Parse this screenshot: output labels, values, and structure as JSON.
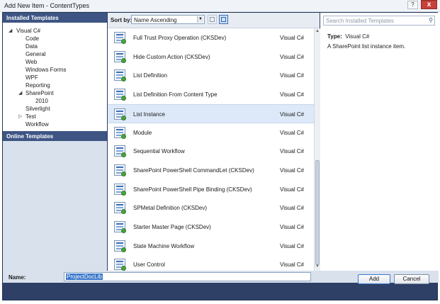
{
  "window": {
    "title": "Add New Item - ContentTypes",
    "help_label": "?",
    "close_label": "x"
  },
  "left": {
    "header": "Installed Templates",
    "tree": [
      {
        "label": "Visual C#",
        "level": 0,
        "arrow": "expanded"
      },
      {
        "label": "Code",
        "level": 1
      },
      {
        "label": "Data",
        "level": 1
      },
      {
        "label": "General",
        "level": 1
      },
      {
        "label": "Web",
        "level": 1
      },
      {
        "label": "Windows Forms",
        "level": 1
      },
      {
        "label": "WPF",
        "level": 1
      },
      {
        "label": "Reporting",
        "level": 1
      },
      {
        "label": "SharePoint",
        "level": 1,
        "arrow": "expanded"
      },
      {
        "label": "2010",
        "level": 2
      },
      {
        "label": "Silverlight",
        "level": 1
      },
      {
        "label": "Test",
        "level": 1,
        "arrow": "collapsed"
      },
      {
        "label": "Workflow",
        "level": 1
      }
    ],
    "online": "Online Templates"
  },
  "toolbar": {
    "sort_label": "Sort by:",
    "sort_value": "Name Ascending"
  },
  "templates": [
    {
      "name": "Full Trust Proxy Operation (CKSDev)",
      "lang": "Visual C#",
      "icon": "csharp-file-icon"
    },
    {
      "name": "Hide Custom Action (CKSDev)",
      "lang": "Visual C#",
      "icon": "custom-action-icon"
    },
    {
      "name": "List Definition",
      "lang": "Visual C#",
      "icon": "list-definition-icon"
    },
    {
      "name": "List Definition From Content Type",
      "lang": "Visual C#",
      "icon": "list-definition-icon"
    },
    {
      "name": "List Instance",
      "lang": "Visual C#",
      "icon": "list-instance-icon",
      "selected": true
    },
    {
      "name": "Module",
      "lang": "Visual C#",
      "icon": "module-icon"
    },
    {
      "name": "Sequential Workflow",
      "lang": "Visual C#",
      "icon": "workflow-icon"
    },
    {
      "name": "SharePoint PowerShell CommandLet (CKSDev)",
      "lang": "Visual C#",
      "icon": "csharp-file-icon"
    },
    {
      "name": "SharePoint PowerShell Pipe Binding (CKSDev)",
      "lang": "Visual C#",
      "icon": "csharp-file-icon"
    },
    {
      "name": "SPMetal Definition (CKSDev)",
      "lang": "Visual C#",
      "icon": "spmetal-icon"
    },
    {
      "name": "Starter Master Page (CKSDev)",
      "lang": "Visual C#",
      "icon": "master-page-icon"
    },
    {
      "name": "State Machine Workflow",
      "lang": "Visual C#",
      "icon": "workflow-icon"
    },
    {
      "name": "User Control",
      "lang": "Visual C#",
      "icon": "user-control-icon"
    }
  ],
  "right": {
    "search_placeholder": "Search Installed Templates",
    "type_label": "Type:",
    "type_value": "Visual C#",
    "description": "A SharePoint list instance item."
  },
  "name_field": {
    "label": "Name:",
    "value": "ProjectDocLib"
  },
  "buttons": {
    "add": "Add",
    "cancel": "Cancel"
  }
}
